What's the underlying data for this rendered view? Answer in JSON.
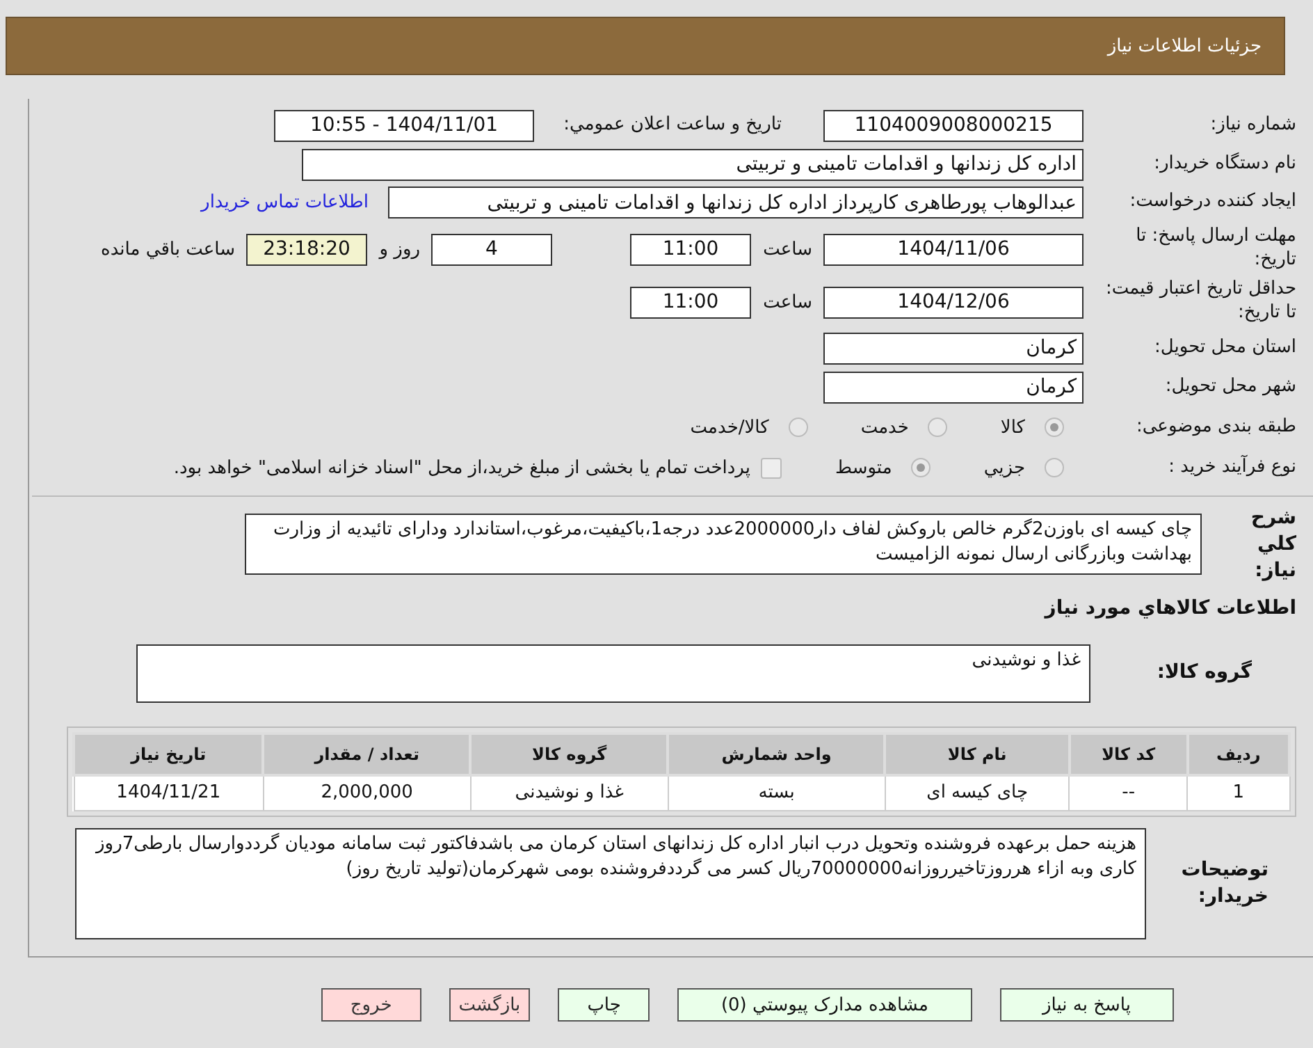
{
  "header": {
    "title": "جزئیات اطلاعات نیاز"
  },
  "fields": {
    "need_number": {
      "label": "شماره نیاز:",
      "value": "1104009008000215"
    },
    "announce": {
      "label": "تاریخ و ساعت اعلان عمومي:",
      "value": "1404/11/01 - 10:55"
    },
    "buyer": {
      "label": "نام دستگاه خریدار:",
      "value": "اداره کل زندانها و اقدامات تامینی و تربیتی"
    },
    "creator": {
      "label": "ایجاد کننده درخواست:",
      "value": "عبدالوهاب پورطاهری کارپرداز اداره کل زندانها و اقدامات تامینی و تربیتی",
      "link": "اطلاعات تماس خریدار"
    },
    "deadline": {
      "label": "مهلت ارسال پاسخ: تا تاریخ:",
      "date": "1404/11/06",
      "time_label": "ساعت",
      "time": "11:00",
      "days": "4",
      "days_label": "روز و",
      "remaining": "23:18:20",
      "remaining_label": "ساعت باقي مانده"
    },
    "validity": {
      "label": "حداقل تاریخ اعتبار قیمت: تا تاریخ:",
      "date": "1404/12/06",
      "time_label": "ساعت",
      "time": "11:00"
    },
    "province": {
      "label": "استان محل تحویل:",
      "value": "کرمان"
    },
    "city": {
      "label": "شهر محل تحویل:",
      "value": "کرمان"
    }
  },
  "category": {
    "label": "طبقه بندی موضوعی:",
    "options": [
      {
        "label": "کالا",
        "selected": true
      },
      {
        "label": "خدمت",
        "selected": false
      },
      {
        "label": "کالا/خدمت",
        "selected": false
      }
    ]
  },
  "purchase_type": {
    "label": "نوع فرآیند خرید :",
    "options": [
      {
        "label": "جزيي",
        "selected": false
      },
      {
        "label": "متوسط",
        "selected": true
      }
    ],
    "treasury": {
      "label": "پرداخت تمام یا بخشی از مبلغ خرید،از محل \"اسناد خزانه اسلامی\" خواهد بود.",
      "checked": false
    }
  },
  "description": {
    "label": "شرح کلي نياز:",
    "value": "چای کیسه ای باوزن2گرم خالص باروکش لفاف دار2000000عدد درجه1،باکیفیت،مرغوب،استاندارد ودارای تائیدیه از وزارت بهداشت وبازرگانی ارسال نمونه الزامیست"
  },
  "goods_section": {
    "title": "اطلاعات کالاهاي مورد نياز",
    "group_label": "گروه کالا:",
    "group_value": "غذا و نوشیدنی"
  },
  "table": {
    "columns": [
      "ردیف",
      "کد کالا",
      "نام کالا",
      "واحد شمارش",
      "گروه کالا",
      "تعداد / مقدار",
      "تاریخ نیاز"
    ],
    "rows": [
      [
        "1",
        "--",
        "چای کیسه ای",
        "بسته",
        "غذا و نوشیدنی",
        "2,000,000",
        "1404/11/21"
      ]
    ]
  },
  "notes": {
    "label": "توضیحات خریدار:",
    "value": "هزینه حمل برعهده فروشنده وتحویل درب انبار اداره کل زندانهای استان کرمان می باشدفاکتور ثبت سامانه مودیان گرددوارسال بارطی7روز کاری وبه ازاء هرروزتاخیرروزانه70000000ریال کسر می گرددفروشنده بومی شهرکرمان(تولید تاریخ روز)"
  },
  "buttons": [
    {
      "label": "پاسخ به نیاز",
      "kind": "primary"
    },
    {
      "label": "مشاهده مدارک پیوستي (0)",
      "kind": "primary"
    },
    {
      "label": "چاپ",
      "kind": "primary"
    },
    {
      "label": "بازگشت",
      "kind": "danger"
    },
    {
      "label": "خروج",
      "kind": "danger"
    }
  ]
}
